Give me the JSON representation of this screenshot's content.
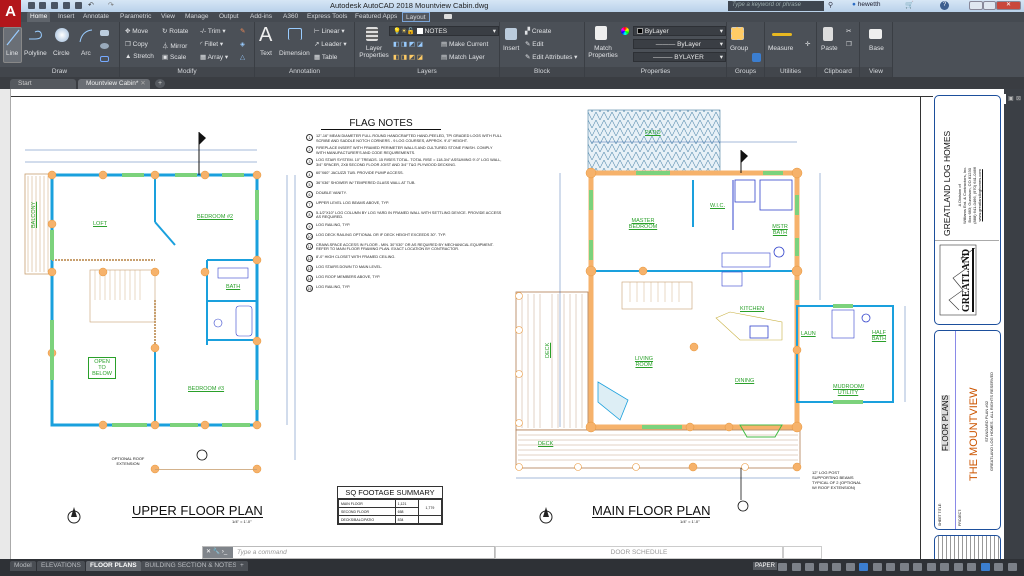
{
  "titlebar": {
    "title": "Autodesk AutoCAD 2018   Mountview Cabin.dwg",
    "search_placeholder": "Type a keyword or phrase",
    "user": "hewetth",
    "app_button": "A"
  },
  "ribbon_tabs": [
    "Home",
    "Insert",
    "Annotate",
    "Parametric",
    "View",
    "Manage",
    "Output",
    "Add-ins",
    "A360",
    "Express Tools",
    "Featured Apps",
    "Layout"
  ],
  "active_tab": "Home",
  "panels": {
    "draw": {
      "title": "Draw",
      "items": [
        "Line",
        "Polyline",
        "Circle",
        "Arc"
      ]
    },
    "modify": {
      "title": "Modify",
      "items": [
        "Move",
        "Rotate",
        "Trim",
        "Copy",
        "Mirror",
        "Fillet",
        "Stretch",
        "Scale",
        "Array"
      ]
    },
    "annotation": {
      "title": "Annotation",
      "items": [
        "Text",
        "Dimension",
        "Linear",
        "Leader",
        "Table"
      ]
    },
    "layers": {
      "title": "Layers",
      "layer_name": "NOTES",
      "layer_props": "Layer Properties",
      "make_current": "Make Current",
      "match_layer": "Match Layer"
    },
    "block": {
      "title": "Block",
      "insert": "Insert",
      "create": "Create",
      "edit": "Edit",
      "edit_attributes": "Edit Attributes"
    },
    "properties": {
      "title": "Properties",
      "match": "Match Properties",
      "color": "ByLayer",
      "lineweight": "ByLayer",
      "linetype": "BYLAYER"
    },
    "groups": {
      "title": "Groups",
      "group": "Group"
    },
    "utilities": {
      "title": "Utilities",
      "measure": "Measure"
    },
    "clipboard": {
      "title": "Clipboard",
      "paste": "Paste"
    },
    "view": {
      "title": "View",
      "base": "Base"
    }
  },
  "file_tabs": [
    {
      "label": "Start"
    },
    {
      "label": "Mountview Cabin*",
      "active": true
    }
  ],
  "drawing": {
    "upper": {
      "title": "UPPER FLOOR PLAN",
      "scale": "1/4\" = 1'-0\"",
      "rooms": [
        "LOFT",
        "BEDROOM #2",
        "BATH",
        "OPEN TO BELOW",
        "BEDROOM #3",
        "BALCONY"
      ],
      "note": "OPTIONAL ROOF EXTENSION"
    },
    "main": {
      "title": "MAIN FLOOR PLAN",
      "scale": "1/4\" = 1'-0\"",
      "rooms": [
        "PATIO",
        "MASTER BEDROOM",
        "W.I.C.",
        "MSTR BATH",
        "KITCHEN",
        "LAUN",
        "HALF BATH",
        "LIVING ROOM",
        "DINING",
        "MUDROOM/ UTILITY",
        "DECK",
        "DECK"
      ],
      "note": "12\" LOG POST SUPPORTING BEAMS TYPICAL OF 2 (OPTIONAL W/ ROOF EXTENSION)"
    },
    "flag_notes": {
      "title": "FLAG NOTES",
      "items": [
        "12\"-16\" mean diameter full round handcrafted hand-peeled, TPI graded logs with full scribe and saddle notch corners - 9 log courses, approx. 9'-0\" height.",
        "Fireplace insert with framed perimeter walls and cultured stone finish. Comply with manufacturer's and code requirements.",
        "Log stair system. 10\" treads. 15 rises total. Total rise = 118-3/4\" assuming 9'-0\" log wall, 3/4\" spacer, 2x8 second floor joist and 3/4\" T&G plywood decking.",
        "60\"x60\" jacuzzi tub. Provide pump access.",
        "36\"x36\" shower w/ tempered glass wall at tub.",
        "Double vanity.",
        "Upper level log beams above, typ.",
        "5-1/2\"x10\" log column by log yard in framed wall with settling device. Provide access as required.",
        "Log railing, typ.",
        "Log deck railing optional or if deck height exceeds 30\". Typ.",
        "Crawlspace access in floor - min. 30\"x30\" or as required by mechanical equipment. Refer to main floor framing plan. Exact location by contractor.",
        "8'-0\" high closet with framed ceiling.",
        "Log stairs down to main level.",
        "Log roof members above, typ.",
        "Log railing, typ."
      ]
    },
    "sq_footage": {
      "title": "SQ FOOTAGE SUMMARY",
      "rows": [
        [
          "MAIN FLOOR",
          "1,121"
        ],
        [
          "SECOND FLOOR",
          "658"
        ],
        [
          "DECKS/BALC/PATIO",
          "834"
        ]
      ],
      "total": "1,779"
    },
    "title_block": {
      "company": "GREATLAND LOG HOMES",
      "division": "A Division of",
      "parent": "Williams Ent. & Contractors, Inc.",
      "address": "Box 683; Gunnison, CO 81230",
      "phone": "(888) 641-0466, (970) 641-0466",
      "web": "www.greatlandloghomes.com",
      "logo_text": "GREATLAND",
      "sheet_title_label": "SHEET TITLE:",
      "sheet_title": "FLOOR PLANS",
      "project_label": "PROJECT:",
      "project": "THE MOUNTVIEW",
      "plan_no": "STANDARD PLAN #02",
      "rights": "GREATLAND LOG HOMES - ALL RIGHTS RESERVED"
    }
  },
  "command_line": {
    "placeholder": "Type a command"
  },
  "door_schedule": "DOOR SCHEDULE",
  "layout_tabs": [
    "Model",
    "ELEVATIONS",
    "FLOOR PLANS",
    "BUILDING SECTION & NOTES"
  ],
  "active_layout": "FLOOR PLANS",
  "status": {
    "space": "PAPER"
  },
  "colors": {
    "wall": "#1aa0dd",
    "log": "#f6b26b",
    "window": "#44bb44",
    "label": "#2aa02a",
    "title_accent": "#cc5500"
  }
}
